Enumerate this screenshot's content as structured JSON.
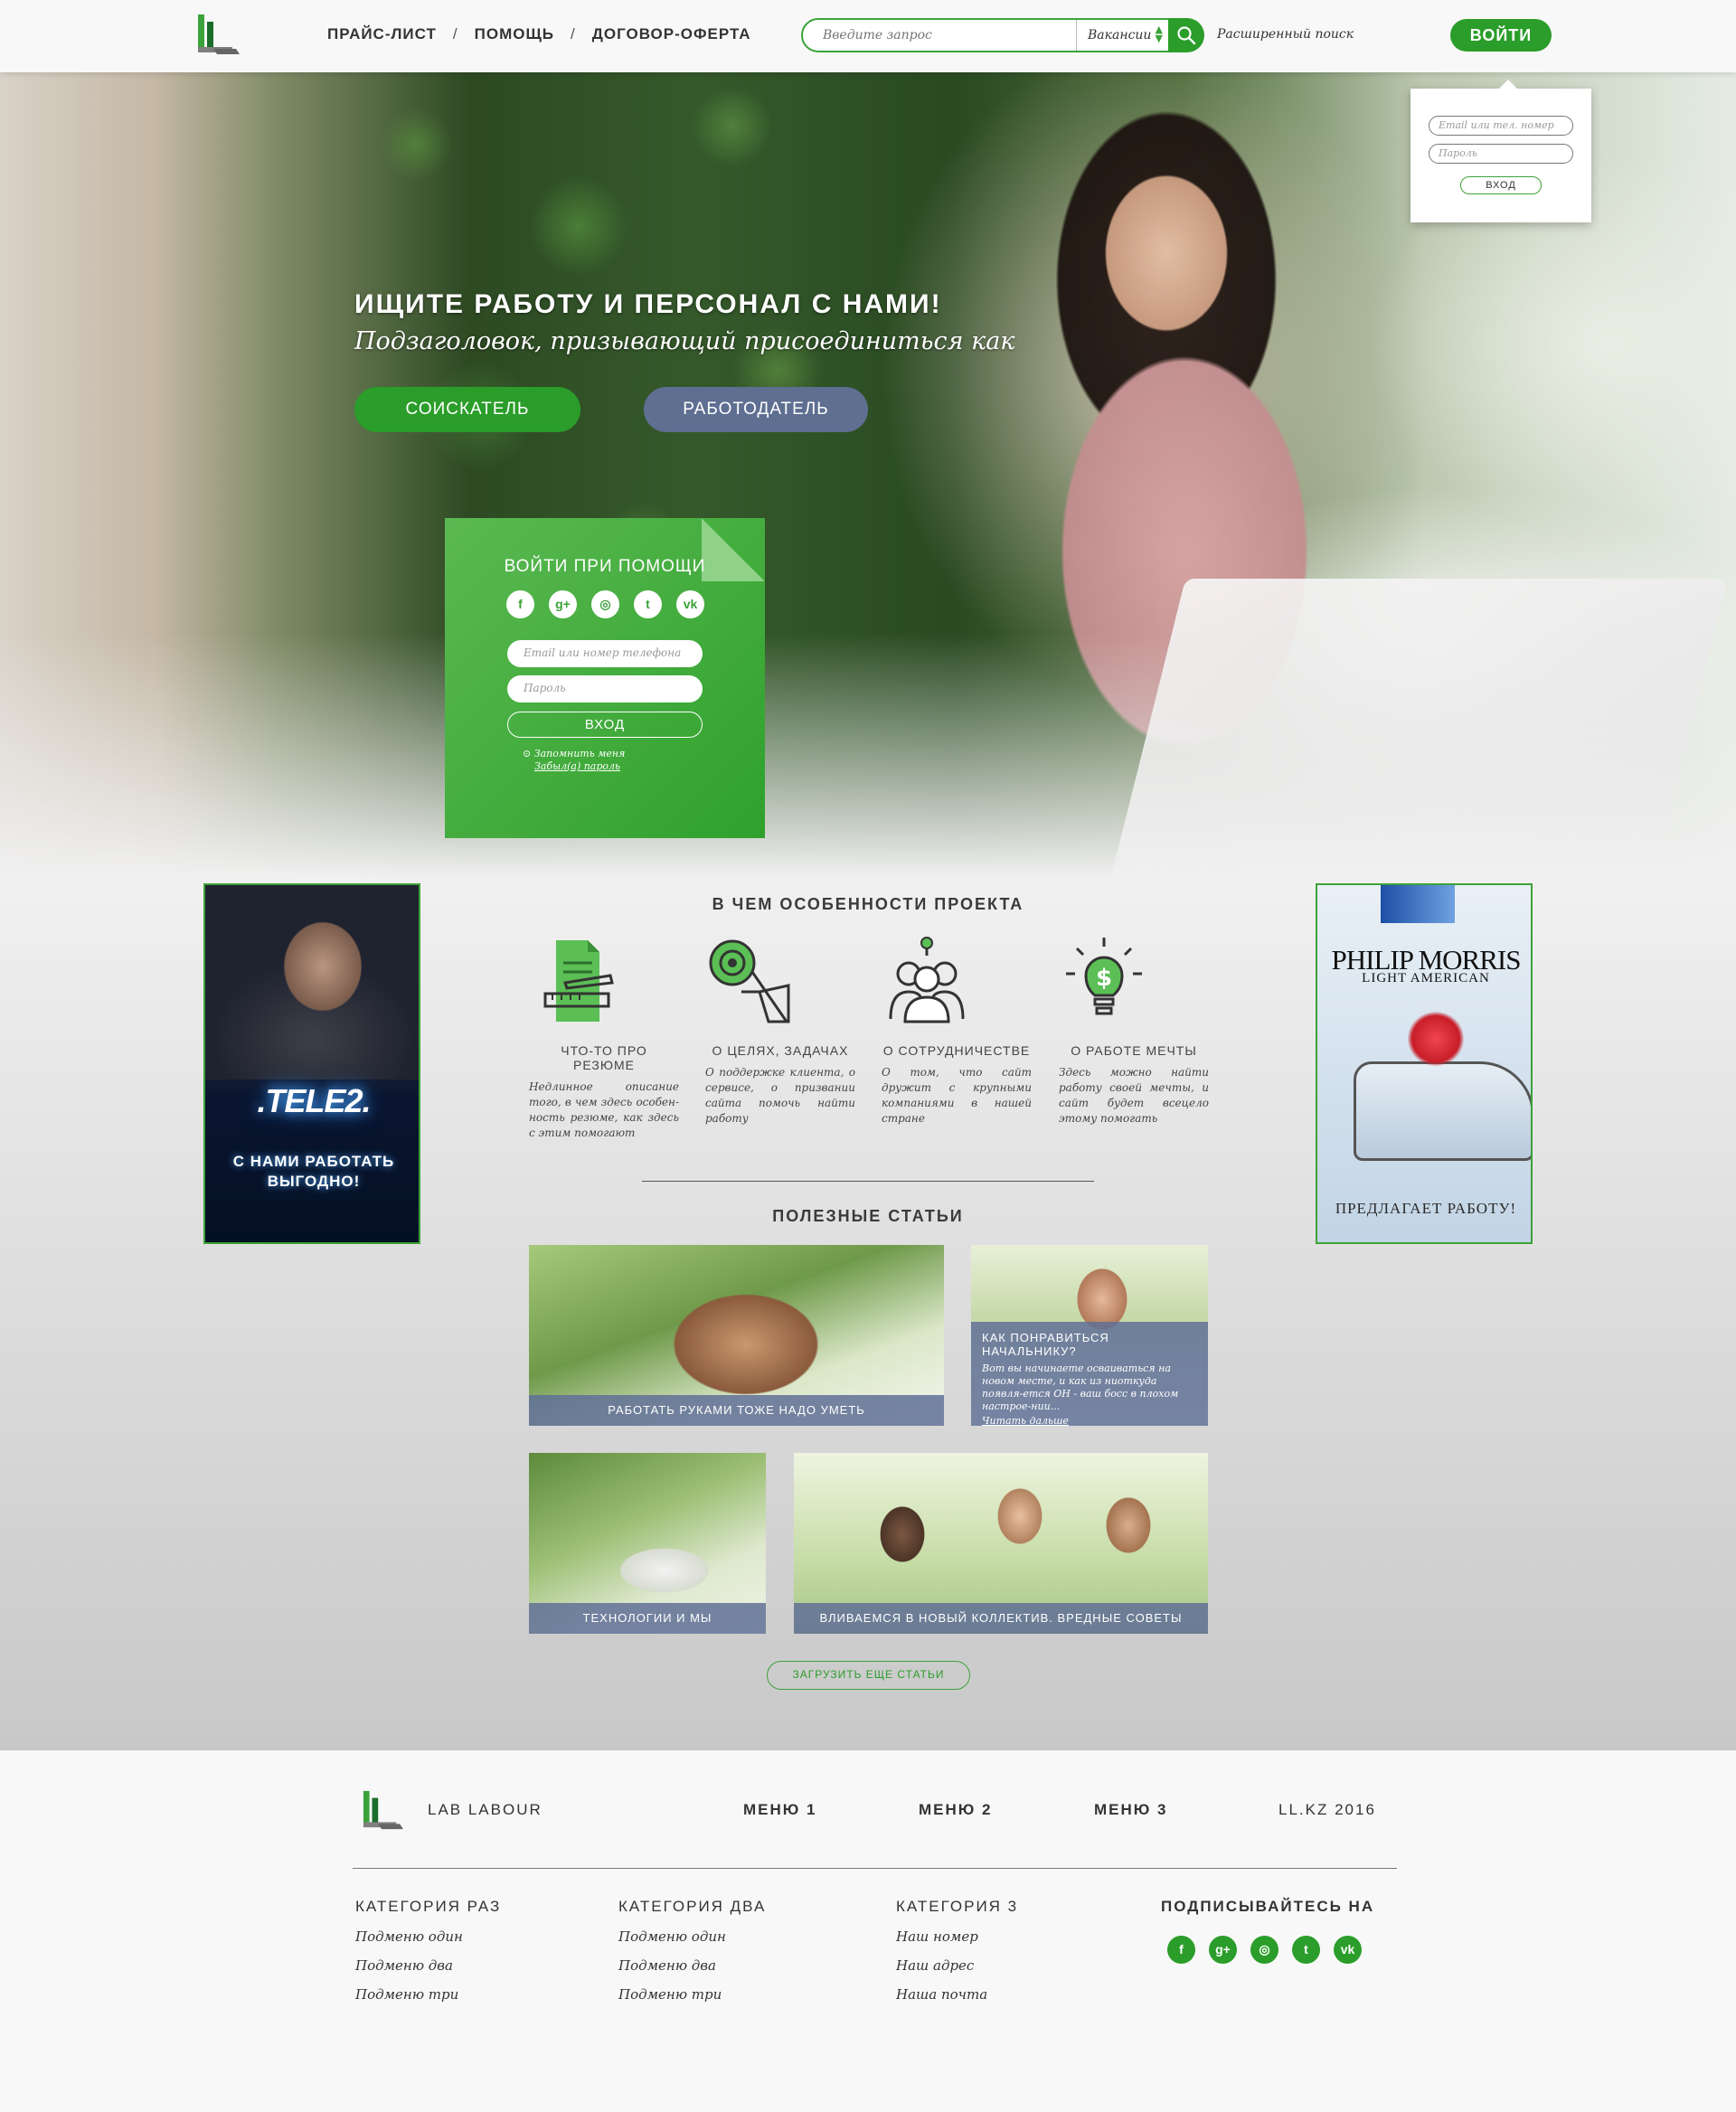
{
  "header": {
    "nav": [
      "ПРАЙС-ЛИСТ",
      "ПОМОЩЬ",
      "ДОГОВОР-ОФЕРТА"
    ],
    "nav_sep": "/",
    "search_placeholder": "Введите запрос",
    "search_category": "Вакансии",
    "advanced_search": "Расширенный поиск",
    "login_button": "ВОЙТИ"
  },
  "login_popover": {
    "email_placeholder": "Email или тел. номер",
    "password_placeholder": "Пароль",
    "submit": "ВХОД"
  },
  "hero": {
    "title": "ИЩИТЕ РАБОТУ И ПЕРСОНАЛ С НАМИ!",
    "subtitle": "Подзаголовок, призывающий присоединиться как",
    "seeker_button": "СОИСКАТЕЛЬ",
    "employer_button": "РАБОТОДАТЕЛЬ"
  },
  "social_login": {
    "title": "ВОЙТИ ПРИ ПОМОЩИ",
    "networks": [
      "f",
      "g+",
      "◎",
      "t",
      "vk"
    ],
    "email_placeholder": "Email или номер телефона",
    "password_placeholder": "Пароль",
    "submit": "ВХОД",
    "remember": "Запомнить меня",
    "forgot": "Забыл(а) пароль"
  },
  "banners": {
    "left": {
      "brand": ".TELE2.",
      "slogan_line1": "С НАМИ РАБОТАТЬ",
      "slogan_line2": "ВЫГОДНО!"
    },
    "right": {
      "brand": "PHILIP MORRIS",
      "sub": "LIGHT AMERICAN",
      "offer": "ПРЕДЛАГАЕТ РАБОТУ!"
    }
  },
  "features": {
    "title": "В ЧЕМ ОСОБЕННОСТИ ПРОЕКТА",
    "items": [
      {
        "title": "ЧТО-ТО ПРО РЕЗЮМЕ",
        "text": "Недлинное описание того, в чем здесь особен-ность резюме, как здесь с этим помогают",
        "icon": "resume-icon"
      },
      {
        "title": "О ЦЕЛЯХ, ЗАДАЧАХ",
        "text": "О поддержке клиента, о сервисе, о призвании сайта помочь найти работу",
        "icon": "target-icon"
      },
      {
        "title": "О СОТРУДНИЧЕСТВЕ",
        "text": "О том, что сайт дружит с крупными компаниями в нашей стране",
        "icon": "team-icon"
      },
      {
        "title": "О РАБОТЕ МЕЧТЫ",
        "text": "Здесь можно найти работу своей мечты, и сайт будет всецело этому помогать",
        "icon": "idea-money-icon"
      }
    ]
  },
  "articles": {
    "title": "ПОЛЕЗНЫЕ СТАТЬИ",
    "items": [
      {
        "caption": "РАБОТАТЬ РУКАМИ ТОЖЕ НАДО УМЕТЬ"
      },
      {
        "caption": "КАК ПОНРАВИТЬСЯ НАЧАЛЬНИКУ?",
        "text": "Вот вы начинаете осваиваться на новом месте, и как из ниоткуда появля-ется ОН - ваш босс в плохом настрое-нии...",
        "read_more": "Читать дальше"
      },
      {
        "caption": "ТЕХНОЛОГИИ И МЫ"
      },
      {
        "caption": "ВЛИВАЕМСЯ В НОВЫЙ КОЛЛЕКТИВ. ВРЕДНЫЕ СОВЕТЫ"
      }
    ],
    "load_more": "ЗАГРУЗИТЬ ЕЩЕ СТАТЬИ"
  },
  "footer": {
    "brand": "LAB LABOUR",
    "menu": [
      "МЕНЮ 1",
      "МЕНЮ 2",
      "МЕНЮ 3"
    ],
    "copyright": "LL.KZ 2016",
    "columns": [
      {
        "title": "КАТЕГОРИЯ РАЗ",
        "links": [
          "Подменю один",
          "Подменю два",
          "Подменю три"
        ]
      },
      {
        "title": "КАТЕГОРИЯ ДВА",
        "links": [
          "Подменю один",
          "Подменю два",
          "Подменю три"
        ]
      },
      {
        "title": "КАТЕГОРИЯ 3",
        "links": [
          "Наш номер",
          "Наш адрес",
          "Наша почта"
        ]
      }
    ],
    "subscribe_title": "ПОДПИСЫВАЙТЕСЬ НА",
    "socials": [
      "f",
      "g+",
      "◎",
      "t",
      "vk"
    ]
  },
  "colors": {
    "green": "#2b9d2a",
    "slate": "#5f6f91",
    "caption": "#607096"
  }
}
